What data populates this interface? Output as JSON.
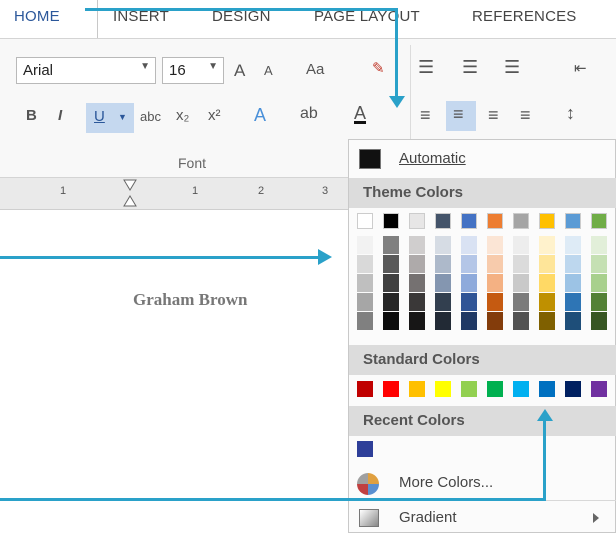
{
  "tabs": [
    "HOME",
    "INSERT",
    "DESIGN",
    "PAGE LAYOUT",
    "REFERENCES"
  ],
  "ribbon": {
    "font_name": "Arial",
    "font_size": "16",
    "grow_font": "A",
    "shrink_font": "A",
    "change_case": "Aa",
    "bold": "B",
    "italic": "I",
    "underline": "U",
    "strikethrough": "abc",
    "subscript": "x₂",
    "superscript": "x²",
    "font_color_letter": "A",
    "group_label": "Font"
  },
  "ruler": {
    "numbers": [
      "1",
      "1",
      "2",
      "3"
    ]
  },
  "document": {
    "text": "Graham Brown"
  },
  "color_menu": {
    "automatic": "Automatic",
    "theme_header": "Theme Colors",
    "standard_header": "Standard Colors",
    "recent_header": "Recent Colors",
    "more_colors": "More Colors...",
    "gradient": "Gradient",
    "theme_top": [
      "#ffffff",
      "#000000",
      "#e7e6e6",
      "#44546a",
      "#4472c4",
      "#ed7d31",
      "#a5a5a5",
      "#ffc000",
      "#5b9bd5",
      "#70ad47"
    ],
    "theme_columns": [
      [
        "#f2f2f2",
        "#d9d9d9",
        "#bfbfbf",
        "#a6a6a6",
        "#808080"
      ],
      [
        "#808080",
        "#595959",
        "#404040",
        "#262626",
        "#0d0d0d"
      ],
      [
        "#d0cece",
        "#aeaaaa",
        "#757171",
        "#3a3838",
        "#171616"
      ],
      [
        "#d6dce4",
        "#adb9ca",
        "#8496b0",
        "#323f4f",
        "#222a35"
      ],
      [
        "#d9e2f3",
        "#b4c6e7",
        "#8eaadb",
        "#2f5496",
        "#1f3864"
      ],
      [
        "#fbe5d5",
        "#f7cbac",
        "#f4b183",
        "#c55a11",
        "#833c0b"
      ],
      [
        "#ededed",
        "#dbdbdb",
        "#c9c9c9",
        "#7b7b7b",
        "#525252"
      ],
      [
        "#fff2cc",
        "#fee599",
        "#ffd965",
        "#bf9000",
        "#7f6000"
      ],
      [
        "#deebf6",
        "#bdd7ee",
        "#9cc3e5",
        "#2e75b5",
        "#1e4e79"
      ],
      [
        "#e2efd9",
        "#c5e0b3",
        "#a8d08d",
        "#538135",
        "#375623"
      ]
    ],
    "standard": [
      "#c00000",
      "#ff0000",
      "#ffc000",
      "#ffff00",
      "#92d050",
      "#00b050",
      "#00b0f0",
      "#0070c0",
      "#002060",
      "#7030a0"
    ],
    "recent": [
      "#2e3f99"
    ]
  }
}
